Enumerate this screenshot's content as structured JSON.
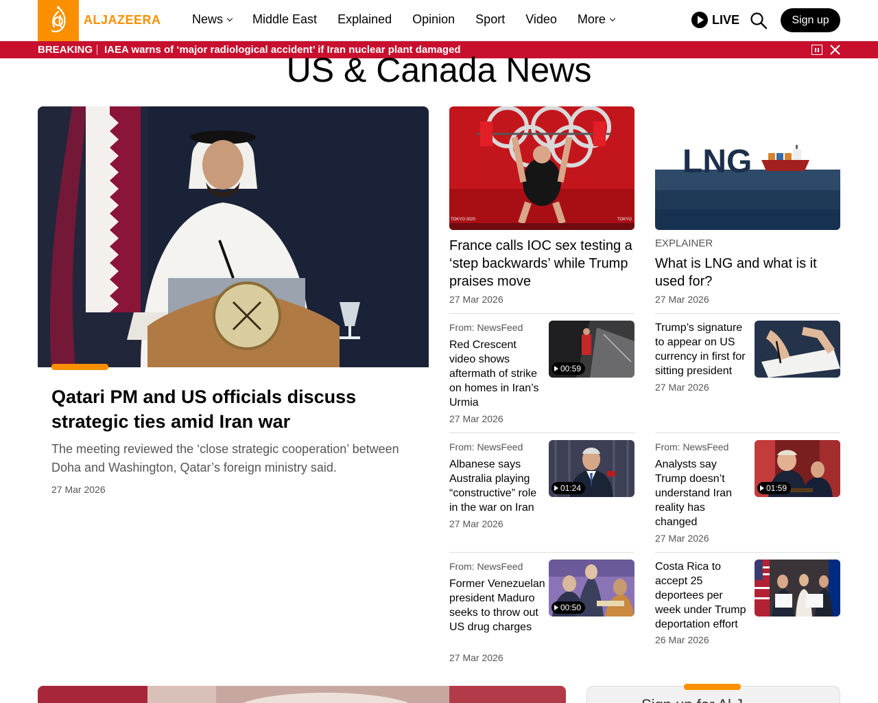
{
  "brand": {
    "name": "ALJAZEERA",
    "accent": "#fa9000",
    "breaking_color": "#c8102e"
  },
  "nav": {
    "items": [
      {
        "label": "News",
        "dropdown": true
      },
      {
        "label": "Middle East",
        "dropdown": false
      },
      {
        "label": "Explained",
        "dropdown": false
      },
      {
        "label": "Opinion",
        "dropdown": false
      },
      {
        "label": "Sport",
        "dropdown": false
      },
      {
        "label": "Video",
        "dropdown": false
      },
      {
        "label": "More",
        "dropdown": true
      }
    ],
    "live_label": "LIVE",
    "signup_label": "Sign up"
  },
  "breaking": {
    "label": "BREAKING",
    "text": "IAEA warns of ‘major radiological accident’ if Iran nuclear plant damaged"
  },
  "page": {
    "title": "US & Canada News"
  },
  "feature": {
    "title": "Qatari PM and US officials discuss strategic ties amid Iran war",
    "description": "The meeting reviewed the ‘close strategic cooperation’ between Doha and Washington, Qatar’s foreign ministry said.",
    "date": "27 Mar 2026"
  },
  "cards": [
    {
      "eyebrow": "",
      "title": "France calls IOC sex testing a ‘step backwards’ while Trump praises move",
      "date": "27 Mar 2026"
    },
    {
      "eyebrow": "EXPLAINER",
      "title": "What is LNG and what is it used for?",
      "date": "27 Mar 2026"
    }
  ],
  "small_cards": [
    {
      "from": "From: NewsFeed",
      "title": "Red Crescent video shows aftermath of strike on homes in Iran’s Urmia",
      "date": "27 Mar 2026",
      "duration": "00:59"
    },
    {
      "from": "",
      "title": "Trump’s signature to appear on US currency in first for sitting president",
      "date": "27 Mar 2026",
      "duration": ""
    },
    {
      "from": "From: NewsFeed",
      "title": "Albanese says Australia playing “constructive” role in the war on Iran",
      "date": "27 Mar 2026",
      "duration": "01:24"
    },
    {
      "from": "From: NewsFeed",
      "title": "Analysts say Trump doesn’t understand Iran reality has changed",
      "date": "27 Mar 2026",
      "duration": "01:59"
    },
    {
      "from": "From: NewsFeed",
      "title": "Former Venezuelan president Maduro seeks to throw out US drug charges",
      "date": "27 Mar 2026",
      "duration": "00:50"
    },
    {
      "from": "",
      "title": "Costa Rica to accept 25 deportees per week under Trump deportation effort",
      "date": "26 Mar 2026",
      "duration": ""
    }
  ],
  "bottom": {
    "card_text": "Sign up for Al J"
  },
  "images": {
    "lng_text": "LNG",
    "olympic_tag_left": "TOKYO 2020",
    "olympic_tag_right": "TOKYO"
  }
}
